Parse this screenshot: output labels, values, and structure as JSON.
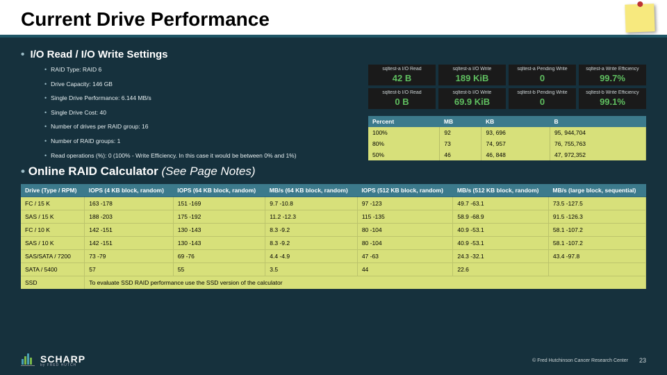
{
  "title": "Current Drive Performance",
  "section1": {
    "heading": "I/O Read / I/O Write Settings"
  },
  "bullets": [
    "RAID Type: RAID 6",
    "Drive Capacity: 146 GB",
    "Single Drive Performance: 6.144 MB/s",
    "Single Drive Cost: 40",
    "Number of drives per RAID group: 16",
    "Number of RAID groups: 1",
    "Read operations (%): 0 (100% - Write Efficiency. In this case it would be between 0% and 1%)"
  ],
  "section2": {
    "heading": "Online RAID Calculator",
    "note": "(See Page Notes)"
  },
  "tiles": [
    {
      "label": "sqltest-a I/O Read",
      "value": "42 B"
    },
    {
      "label": "sqltest-a I/O Write",
      "value": "189 KiB"
    },
    {
      "label": "sqltest-a Pending Write",
      "value": "0"
    },
    {
      "label": "sqltest-a Write Efficiency",
      "value": "99.7%"
    },
    {
      "label": "sqltest-b I/O Read",
      "value": "0 B"
    },
    {
      "label": "sqltest-b I/O Write",
      "value": "69.9 KiB"
    },
    {
      "label": "sqltest-b Pending Write",
      "value": "0"
    },
    {
      "label": "sqltest-b Write Efficiency",
      "value": "99.1%"
    }
  ],
  "percent_table": {
    "headers": [
      "Percent",
      "MB",
      "KB",
      "B"
    ],
    "rows": [
      [
        "100%",
        "92",
        "93, 696",
        "95, 944,704"
      ],
      [
        "80%",
        "73",
        "74, 957",
        "76, 755,763"
      ],
      [
        "50%",
        "46",
        "46, 848",
        "47, 972,352"
      ]
    ]
  },
  "big_table": {
    "headers": [
      "Drive (Type / RPM)",
      "IOPS (4 KB block, random)",
      "IOPS (64 KB block, random)",
      "MB/s (64 KB block, random)",
      "IOPS (512 KB block, random)",
      "MB/s (512 KB block, random)",
      "MB/s (large block, sequential)"
    ],
    "rows": [
      [
        "FC / 15 K",
        "163 -178",
        "151 -169",
        "9.7 -10.8",
        "97 -123",
        "49.7 -63.1",
        "73.5 -127.5"
      ],
      [
        "SAS / 15 K",
        "188 -203",
        "175 -192",
        "11.2 -12.3",
        "115 -135",
        "58.9 -68.9",
        "91.5 -126.3"
      ],
      [
        "FC / 10 K",
        "142 -151",
        "130 -143",
        "8.3 -9.2",
        "80 -104",
        "40.9 -53.1",
        "58.1 -107.2"
      ],
      [
        "SAS / 10 K",
        "142 -151",
        "130 -143",
        "8.3 -9.2",
        "80 -104",
        "40.9 -53.1",
        "58.1 -107.2"
      ],
      [
        "SAS/SATA / 7200",
        "73 -79",
        "69 -76",
        "4.4 -4.9",
        "47 -63",
        "24.3 -32.1",
        "43.4 -97.8"
      ],
      [
        "SATA / 5400",
        "57",
        "55",
        "3.5",
        "44",
        "22.6",
        ""
      ]
    ],
    "ssd_row_label": "SSD",
    "ssd_note": "To evaluate SSD RAID performance use the SSD version of the calculator"
  },
  "logo": {
    "name": "SCHARP",
    "sub": "by FRED HUTCH"
  },
  "copyright": "© Fred Hutchinson Cancer Research Center",
  "page_number": "23"
}
